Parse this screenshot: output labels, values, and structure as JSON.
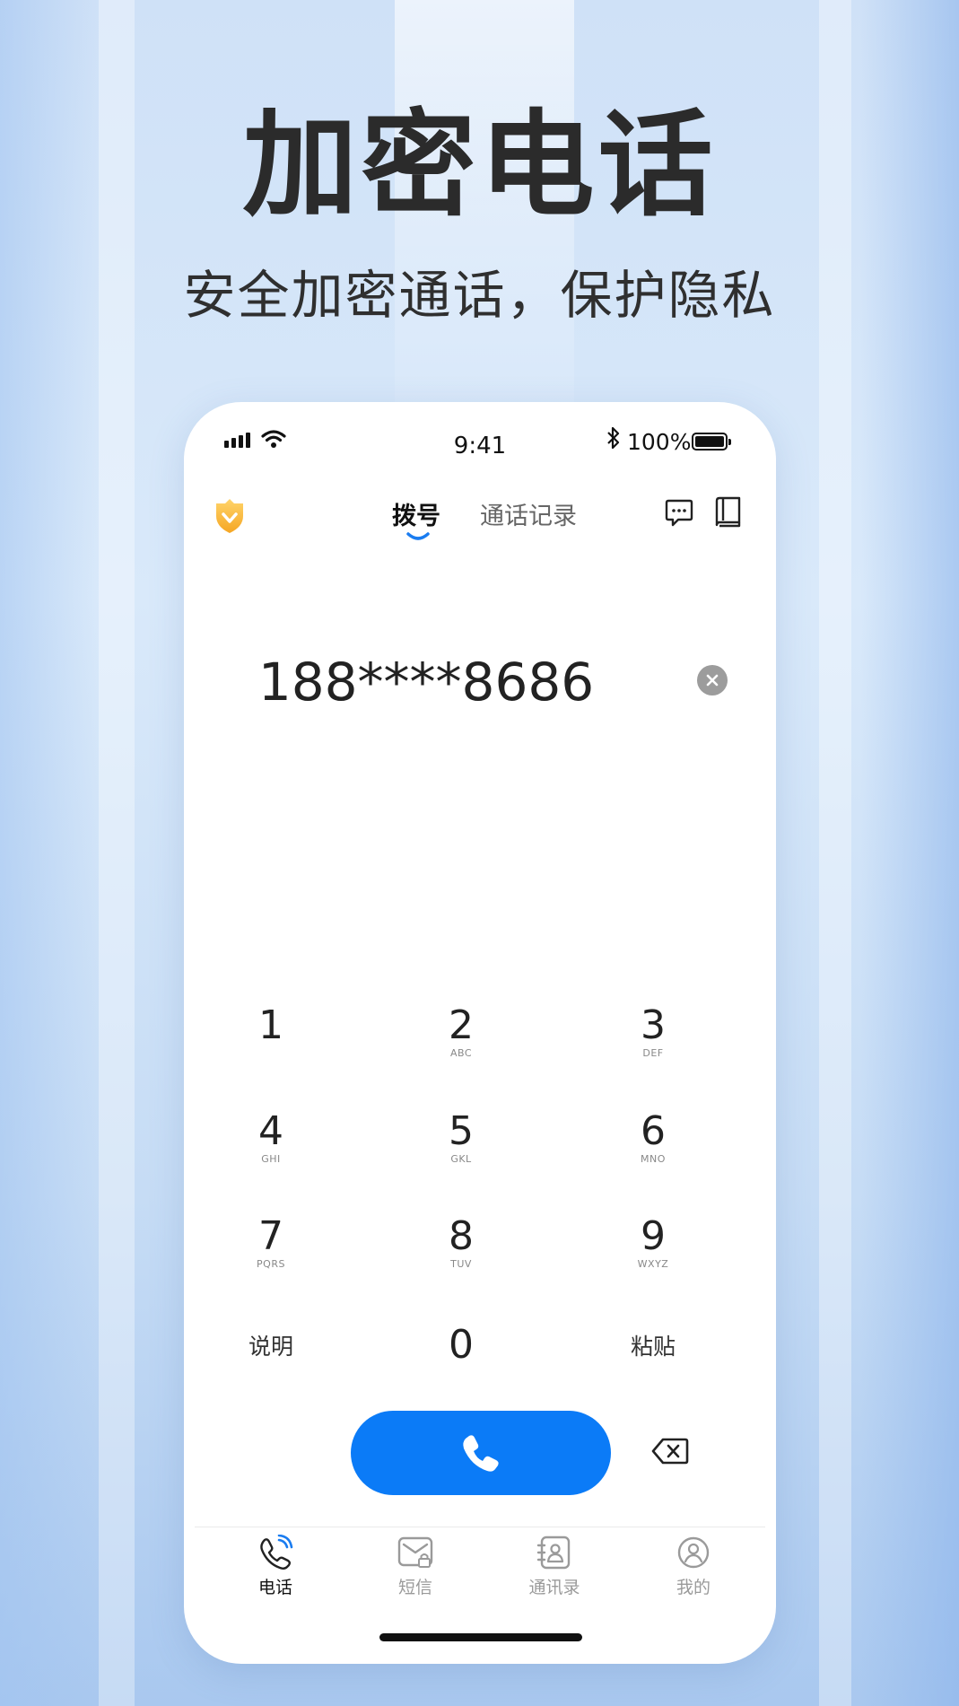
{
  "hero": {
    "title": "加密电话",
    "subtitle": "安全加密通话，保护隐私"
  },
  "status_bar": {
    "time": "9:41",
    "battery": "100%"
  },
  "header": {
    "tabs": [
      {
        "label": "拨号",
        "active": true
      },
      {
        "label": "通话记录",
        "active": false
      }
    ],
    "icons": [
      "shield-icon",
      "message-icon",
      "contacts-book-icon"
    ],
    "accent": "#1a7cf0"
  },
  "dialer": {
    "number": "188****8686"
  },
  "keypad": [
    {
      "digit": "1",
      "letters": ""
    },
    {
      "digit": "2",
      "letters": "ABC"
    },
    {
      "digit": "3",
      "letters": "DEF"
    },
    {
      "digit": "4",
      "letters": "GHI"
    },
    {
      "digit": "5",
      "letters": "GKL"
    },
    {
      "digit": "6",
      "letters": "MNO"
    },
    {
      "digit": "7",
      "letters": "PQRS"
    },
    {
      "digit": "8",
      "letters": "TUV"
    },
    {
      "digit": "9",
      "letters": "WXYZ"
    }
  ],
  "bottom_row": {
    "left": "说明",
    "zero": "0",
    "right": "粘贴"
  },
  "call_button": {
    "color": "#0b7bf7",
    "icon": "phone-icon"
  },
  "tab_bar": [
    {
      "label": "电话",
      "icon": "phone-call-icon",
      "active": true
    },
    {
      "label": "短信",
      "icon": "sms-lock-icon",
      "active": false
    },
    {
      "label": "通讯录",
      "icon": "contacts-icon",
      "active": false
    },
    {
      "label": "我的",
      "icon": "profile-icon",
      "active": false
    }
  ]
}
